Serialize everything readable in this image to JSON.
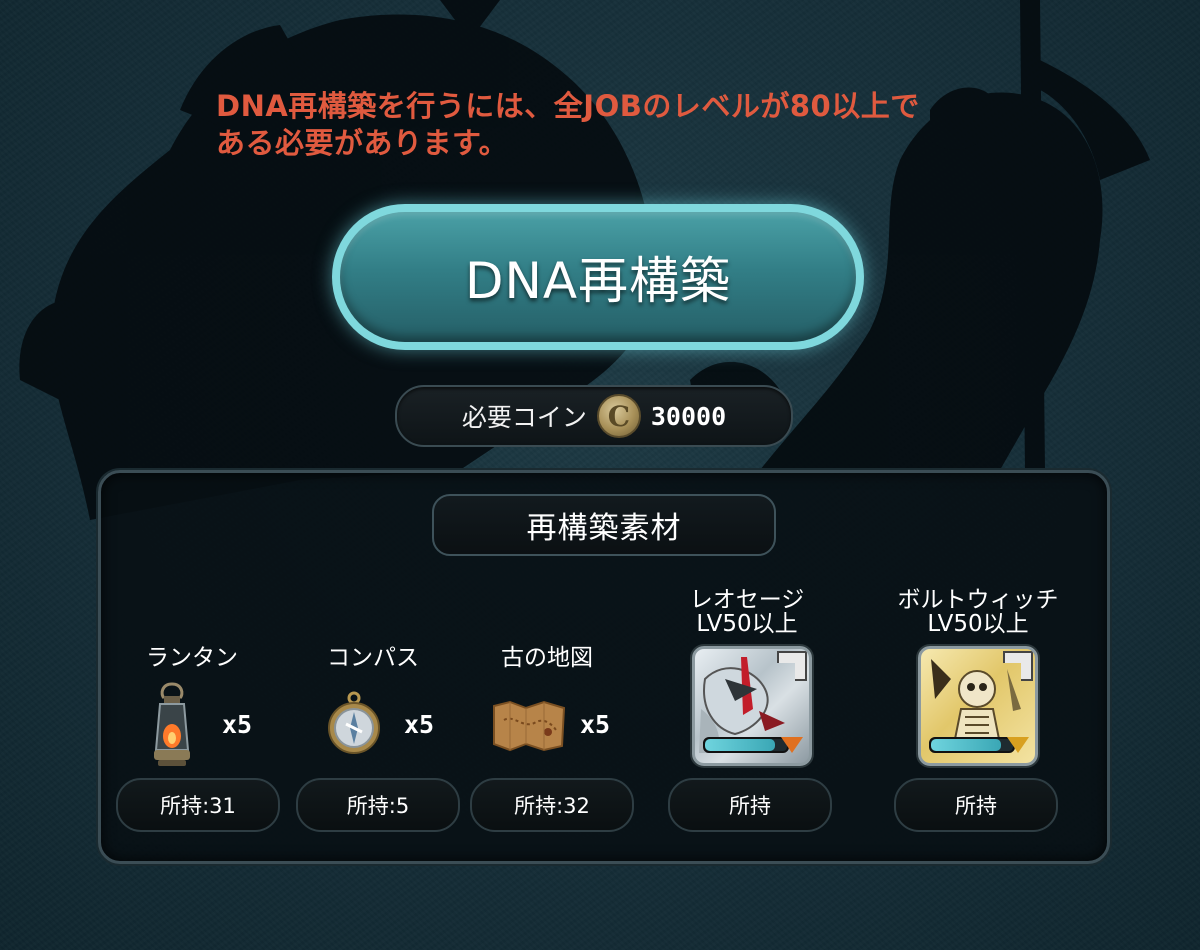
{
  "notice": {
    "line1": "DNA再構築を行うには、全JOBのレベルが80以上で",
    "line2": "ある必要があります。"
  },
  "main_button": {
    "label": "DNA再構築"
  },
  "cost": {
    "label": "必要コイン",
    "coin_symbol": "C",
    "amount": "30000"
  },
  "materials_panel": {
    "title": "再構築素材",
    "items": [
      {
        "name": "ランタン",
        "quantity": "x5",
        "owned": "所持:31",
        "icon": "lantern-icon"
      },
      {
        "name": "コンパス",
        "quantity": "x5",
        "owned": "所持:5",
        "icon": "compass-icon"
      },
      {
        "name": "古の地図",
        "quantity": "x5",
        "owned": "所持:32",
        "icon": "map-icon"
      }
    ],
    "characters": [
      {
        "name": "レオセージ",
        "requirement": "LV50以上",
        "owned": "所持",
        "level_fill": 0.85
      },
      {
        "name": "ボルトウィッチ",
        "requirement": "LV50以上",
        "owned": "所持",
        "level_fill": 0.85
      }
    ]
  },
  "colors": {
    "notice_text": "#e05a3f",
    "button_glow": "#7fd8dd",
    "button_fill": "#327e86",
    "panel_border": "#3b4d55"
  }
}
